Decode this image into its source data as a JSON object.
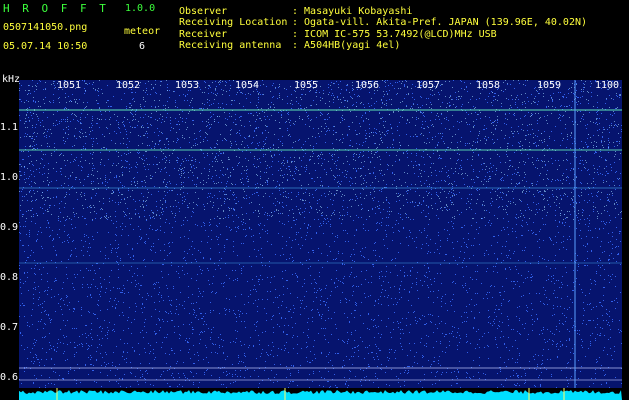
{
  "header": {
    "app_name": "H R O F F T",
    "version": "1.0.0",
    "filename": "0507141050.png",
    "datetime": "05.07.14 10:50",
    "meteor_label": "meteor",
    "meteor_count": "6"
  },
  "info": {
    "observer_label": "Observer",
    "observer_value": ": Masayuki Kobayashi",
    "location_label": "Receiving Location",
    "location_value": ": Ogata-vill. Akita-Pref. JAPAN (139.96E, 40.02N)",
    "receiver_label": "Receiver",
    "receiver_value": ": ICOM IC-575 53.7492(@LCD)MHz USB",
    "antenna_label": "Receiving antenna",
    "antenna_value": ": A504HB(yagi 4el)"
  },
  "axis": {
    "unit": "kHz",
    "y_ticks": [
      "1.1",
      "1.0",
      "0.9",
      "0.8",
      "0.7",
      "0.6"
    ],
    "x_ticks": [
      "1051",
      "1052",
      "1053",
      "1054",
      "1055",
      "1056",
      "1057",
      "1058",
      "1059",
      "1100"
    ]
  },
  "colors": {
    "background": "#000000",
    "spectrogram_base": "#06146e",
    "noise": "#3a6cff",
    "signal": "#7cffb0",
    "baseline": "#00e0ff",
    "header_green": "#3cff3c",
    "header_yellow": "#ffff3c"
  }
}
